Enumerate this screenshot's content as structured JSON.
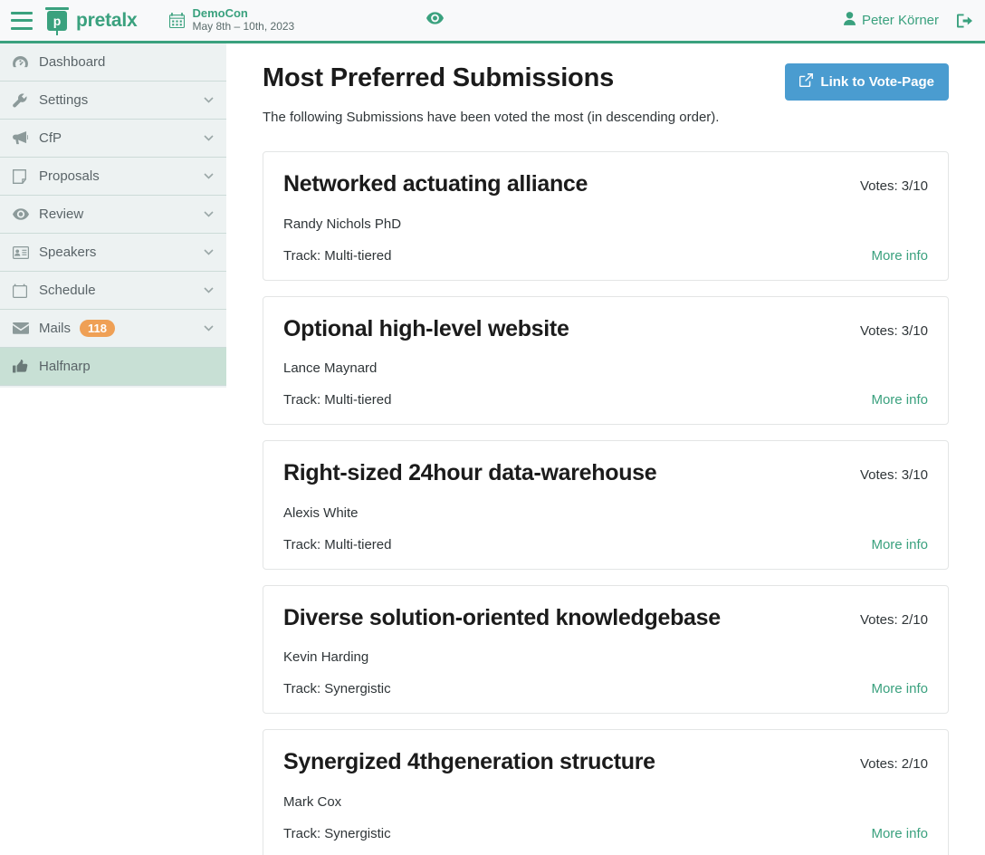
{
  "header": {
    "menu_icon": "hamburger-icon",
    "brand": "pretalx",
    "brand_logo_letter": "p",
    "calendar_icon": "calendar-icon",
    "event_name": "DemoCon",
    "event_dates": "May 8th – 10th, 2023",
    "preview_icon": "eye-icon",
    "user_icon": "user-icon",
    "user_name": "Peter Körner",
    "logout_icon": "logout-icon",
    "accent_color": "#3aa17e"
  },
  "sidebar": {
    "items": [
      {
        "label": "Dashboard",
        "icon": "dashboard-icon",
        "expandable": false,
        "active": false
      },
      {
        "label": "Settings",
        "icon": "wrench-icon",
        "expandable": true,
        "active": false
      },
      {
        "label": "CfP",
        "icon": "bullhorn-icon",
        "expandable": true,
        "active": false
      },
      {
        "label": "Proposals",
        "icon": "document-icon",
        "expandable": true,
        "active": false
      },
      {
        "label": "Review",
        "icon": "eye-icon",
        "expandable": true,
        "active": false
      },
      {
        "label": "Speakers",
        "icon": "id-card-icon",
        "expandable": true,
        "active": false
      },
      {
        "label": "Schedule",
        "icon": "calendar-icon",
        "expandable": true,
        "active": false
      },
      {
        "label": "Mails",
        "icon": "envelope-icon",
        "expandable": true,
        "active": false,
        "badge": "118"
      },
      {
        "label": "Halfnarp",
        "icon": "thumbs-up-icon",
        "expandable": false,
        "active": true
      }
    ],
    "badge_color": "#efa055",
    "active_color": "#c8e0d5"
  },
  "main": {
    "title": "Most Preferred Submissions",
    "subtitle": "The following Submissions have been voted the most (in descending order).",
    "vote_button": {
      "label": "Link to Vote-Page",
      "icon": "external-link-icon",
      "color": "#4a9cd0"
    },
    "more_info_label": "More info",
    "submissions": [
      {
        "title": "Networked actuating alliance",
        "speaker": "Randy Nichols PhD",
        "votes": "Votes: 3/10",
        "track": "Track: Multi-tiered",
        "more_info": "More info"
      },
      {
        "title": "Optional high-level website",
        "speaker": "Lance Maynard",
        "votes": "Votes: 3/10",
        "track": "Track: Multi-tiered",
        "more_info": "More info"
      },
      {
        "title": "Right-sized 24hour data-warehouse",
        "speaker": "Alexis White",
        "votes": "Votes: 3/10",
        "track": "Track: Multi-tiered",
        "more_info": "More info"
      },
      {
        "title": "Diverse solution-oriented knowledgebase",
        "speaker": "Kevin Harding",
        "votes": "Votes: 2/10",
        "track": "Track: Synergistic",
        "more_info": "More info"
      },
      {
        "title": "Synergized 4thgeneration structure",
        "speaker": "Mark Cox",
        "votes": "Votes: 2/10",
        "track": "Track: Synergistic",
        "more_info": "More info"
      }
    ]
  }
}
